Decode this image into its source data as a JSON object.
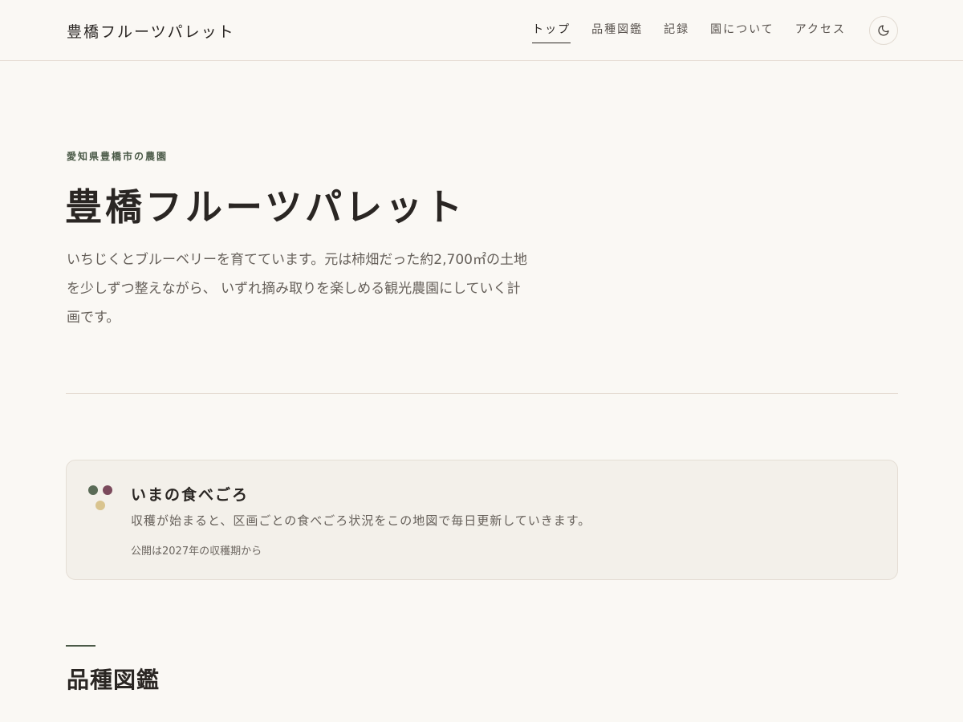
{
  "header": {
    "brand": "豊橋フルーツパレット",
    "nav": [
      {
        "label": "トップ",
        "active": true
      },
      {
        "label": "品種図鑑",
        "active": false
      },
      {
        "label": "記録",
        "active": false
      },
      {
        "label": "園について",
        "active": false
      },
      {
        "label": "アクセス",
        "active": false
      }
    ],
    "theme_toggle_icon": "moon-icon"
  },
  "hero": {
    "eyebrow": "愛知県豊橋市の農園",
    "title": "豊橋フルーツパレット",
    "lead": "いちじくとブルーベリーを育てています。元は柿畑だった約2,700㎡の土地を少しずつ整えながら、 いずれ摘み取りを楽しめる観光農園にしていく計画です。"
  },
  "harvest_card": {
    "title": "いまの食べごろ",
    "description": "収穫が始まると、区画ごとの食べごろ状況をこの地図で毎日更新していきます。",
    "note": "公開は2027年の収穫期から",
    "dot_colors": [
      "#5a6b57",
      "#7b4a5c",
      "#d9c48f"
    ]
  },
  "varieties_section": {
    "title": "品種図鑑",
    "accent_color": "#4b5a48"
  },
  "colors": {
    "background": "#faf8f4",
    "card_background": "#f3f0ea",
    "accent_green": "#4b5a48",
    "text_dark": "#2a2623",
    "text_muted": "#66605a"
  }
}
